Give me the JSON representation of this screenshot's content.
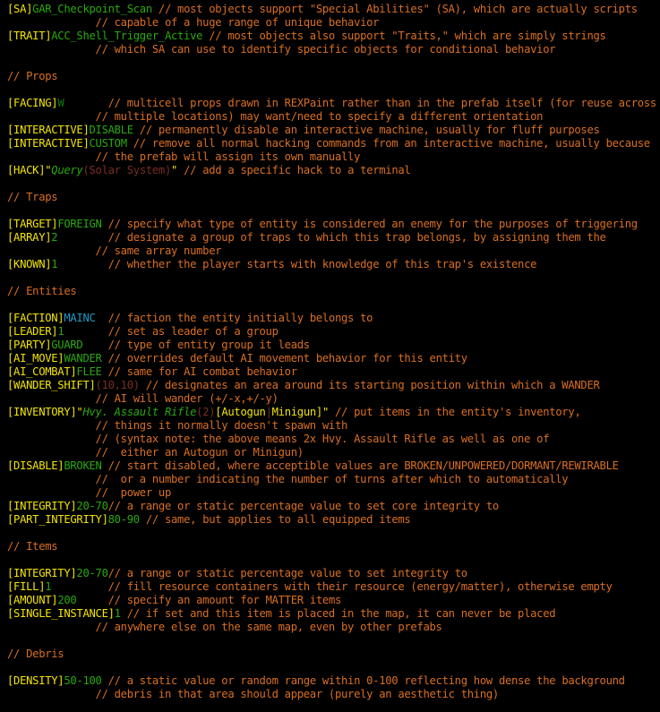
{
  "colors": {
    "background": "#000000",
    "comment": "#d96f21",
    "tag": "#f2e400",
    "value": "#2aa80f",
    "value_dim": "#127a12",
    "faction": "#1e9ac7",
    "syntax": "#7a2d22",
    "string": "#f2e400"
  },
  "lines": [
    [
      {
        "t": "[SA]",
        "c": "tag"
      },
      {
        "t": "GAR_Checkpoint_Scan",
        "c": "value"
      },
      {
        "t": " // most objects support \"Special Abilities\" (SA), which are actually scripts",
        "c": "comment"
      }
    ],
    [
      {
        "t": "              // capable of a huge range of unique behavior",
        "c": "comment"
      }
    ],
    [
      {
        "t": "[TRAIT]",
        "c": "tag"
      },
      {
        "t": "ACC_Shell_Trigger_Active",
        "c": "value"
      },
      {
        "t": " // most objects also support \"Traits,\" which are simply strings",
        "c": "comment"
      }
    ],
    [
      {
        "t": "              // which SA can use to identify specific objects for conditional behavior",
        "c": "comment"
      }
    ],
    [],
    [
      {
        "t": "// Props",
        "c": "comment"
      }
    ],
    [],
    [
      {
        "t": "[FACING]",
        "c": "tag"
      },
      {
        "t": "W",
        "c": "value_dim"
      },
      {
        "t": "       // multicell props drawn in REXPaint rather than in the prefab itself (for reuse across",
        "c": "comment"
      }
    ],
    [
      {
        "t": "              // multiple locations) may want/need to specify a different orientation",
        "c": "comment"
      }
    ],
    [
      {
        "t": "[INTERACTIVE]",
        "c": "tag"
      },
      {
        "t": "DISABLE",
        "c": "value"
      },
      {
        "t": " // permanently disable an interactive machine, usually for fluff purposes",
        "c": "comment"
      }
    ],
    [
      {
        "t": "[INTERACTIVE]",
        "c": "tag"
      },
      {
        "t": "CUSTOM",
        "c": "value"
      },
      {
        "t": " // remove all normal hacking commands from an interactive machine, usually because",
        "c": "comment"
      }
    ],
    [
      {
        "t": "              // the prefab will assign its own manually",
        "c": "comment"
      }
    ],
    [
      {
        "t": "[HACK]",
        "c": "tag"
      },
      {
        "t": "\"",
        "c": "string"
      },
      {
        "t": "Query",
        "c": "value_italic"
      },
      {
        "t": "(Solar System)",
        "c": "syntax"
      },
      {
        "t": "\"",
        "c": "string"
      },
      {
        "t": " // add a specific hack to a terminal",
        "c": "comment"
      }
    ],
    [],
    [
      {
        "t": "// Traps",
        "c": "comment"
      }
    ],
    [],
    [
      {
        "t": "[TARGET]",
        "c": "tag"
      },
      {
        "t": "FOREIGN",
        "c": "value"
      },
      {
        "t": " // specify what type of entity is considered an enemy for the purposes of triggering",
        "c": "comment"
      }
    ],
    [
      {
        "t": "[ARRAY]",
        "c": "tag"
      },
      {
        "t": "2",
        "c": "value"
      },
      {
        "t": "        // designate a group of traps to which this trap belongs, by assigning them the",
        "c": "comment"
      }
    ],
    [
      {
        "t": "              // same array number",
        "c": "comment"
      }
    ],
    [
      {
        "t": "[KNOWN]",
        "c": "tag"
      },
      {
        "t": "1",
        "c": "value"
      },
      {
        "t": "        // whether the player starts with knowledge of this trap's existence",
        "c": "comment"
      }
    ],
    [],
    [
      {
        "t": "// Entities",
        "c": "comment"
      }
    ],
    [],
    [
      {
        "t": "[FACTION]",
        "c": "tag"
      },
      {
        "t": "MAINC",
        "c": "faction"
      },
      {
        "t": "  // faction the entity initially belongs to",
        "c": "comment"
      }
    ],
    [
      {
        "t": "[LEADER]",
        "c": "tag"
      },
      {
        "t": "1",
        "c": "value"
      },
      {
        "t": "       // set as leader of a group",
        "c": "comment"
      }
    ],
    [
      {
        "t": "[PARTY]",
        "c": "tag"
      },
      {
        "t": "GUARD",
        "c": "value"
      },
      {
        "t": "    // type of entity group it leads",
        "c": "comment"
      }
    ],
    [
      {
        "t": "[AI_MOVE]",
        "c": "tag"
      },
      {
        "t": "WANDER",
        "c": "value"
      },
      {
        "t": " // overrides default AI movement behavior for this entity",
        "c": "comment"
      }
    ],
    [
      {
        "t": "[AI_COMBAT]",
        "c": "tag"
      },
      {
        "t": "FLEE",
        "c": "value"
      },
      {
        "t": " // same for AI combat behavior",
        "c": "comment"
      }
    ],
    [
      {
        "t": "[WANDER_SHIFT]",
        "c": "tag"
      },
      {
        "t": "(10,10)",
        "c": "syntax"
      },
      {
        "t": " // designates an area around its starting position within which a WANDER",
        "c": "comment"
      }
    ],
    [
      {
        "t": "              // AI will wander (+/-x,+/-y)",
        "c": "comment"
      }
    ],
    [
      {
        "t": "[INVENTORY]",
        "c": "tag"
      },
      {
        "t": "\"",
        "c": "string"
      },
      {
        "t": "Hvy. Assault Rifle",
        "c": "value_italic"
      },
      {
        "t": "(2)",
        "c": "syntax"
      },
      {
        "t": "[",
        "c": "string"
      },
      {
        "t": "Autogun",
        "c": "string"
      },
      {
        "t": "|",
        "c": "syntax"
      },
      {
        "t": "Minigun",
        "c": "string"
      },
      {
        "t": "]\"",
        "c": "string"
      },
      {
        "t": " // put items in the entity's inventory,",
        "c": "comment"
      }
    ],
    [
      {
        "t": "              // things it normally doesn't spawn with",
        "c": "comment"
      }
    ],
    [
      {
        "t": "              // (syntax note: the above means 2x Hvy. Assault Rifle as well as one of",
        "c": "comment"
      }
    ],
    [
      {
        "t": "              //  either an Autogun or Minigun)",
        "c": "comment"
      }
    ],
    [
      {
        "t": "[DISABLE]",
        "c": "tag"
      },
      {
        "t": "BROKEN",
        "c": "value"
      },
      {
        "t": " // start disabled, where acceptible values are BROKEN/UNPOWERED/DORMANT/REWIRABLE",
        "c": "comment"
      }
    ],
    [
      {
        "t": "              //  or a number indicating the number of turns after which to automatically",
        "c": "comment"
      }
    ],
    [
      {
        "t": "              //  power up",
        "c": "comment"
      }
    ],
    [
      {
        "t": "[INTEGRITY]",
        "c": "tag"
      },
      {
        "t": "20-70",
        "c": "value"
      },
      {
        "t": "// a range or static percentage value to set core integrity to",
        "c": "comment"
      }
    ],
    [
      {
        "t": "[PART_INTEGRITY]",
        "c": "tag"
      },
      {
        "t": "80-90",
        "c": "value"
      },
      {
        "t": " // same, but applies to all equipped items",
        "c": "comment"
      }
    ],
    [],
    [
      {
        "t": "// Items",
        "c": "comment"
      }
    ],
    [],
    [
      {
        "t": "[INTEGRITY]",
        "c": "tag"
      },
      {
        "t": "20-70",
        "c": "value"
      },
      {
        "t": "// a range or static percentage value to set integrity to",
        "c": "comment"
      }
    ],
    [
      {
        "t": "[FILL]",
        "c": "tag"
      },
      {
        "t": "1",
        "c": "value"
      },
      {
        "t": "         // fill resource containers with their resource (energy/matter), otherwise empty",
        "c": "comment"
      }
    ],
    [
      {
        "t": "[AMOUNT]",
        "c": "tag"
      },
      {
        "t": "200",
        "c": "value"
      },
      {
        "t": "     // specify an amount for MATTER items",
        "c": "comment"
      }
    ],
    [
      {
        "t": "[SINGLE_INSTANCE]",
        "c": "tag"
      },
      {
        "t": "1",
        "c": "value"
      },
      {
        "t": " // if set and this item is placed in the map, it can never be placed",
        "c": "comment"
      }
    ],
    [
      {
        "t": "              // anywhere else on the same map, even by other prefabs",
        "c": "comment"
      }
    ],
    [],
    [
      {
        "t": "// Debris",
        "c": "comment"
      }
    ],
    [],
    [
      {
        "t": "[DENSITY]",
        "c": "tag"
      },
      {
        "t": "50-100",
        "c": "value"
      },
      {
        "t": " // a static value or random range within 0-100 reflecting how dense the background",
        "c": "comment"
      }
    ],
    [
      {
        "t": "              // debris in that area should appear (purely an aesthetic thing)",
        "c": "comment"
      }
    ]
  ]
}
